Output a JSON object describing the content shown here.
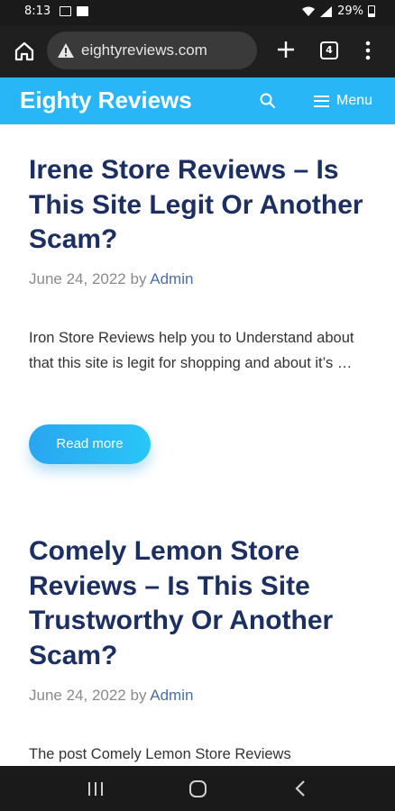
{
  "status_bar": {
    "time": "8:13",
    "battery": "29%",
    "icons": [
      "image-icon",
      "folder-icon",
      "wifi-icon",
      "signal-icon",
      "battery-icon"
    ]
  },
  "browser": {
    "url": "eightyreviews.com",
    "tab_count": "4",
    "icons": [
      "home-icon",
      "warning-icon",
      "plus-icon",
      "tabs-icon",
      "kebab-menu-icon"
    ]
  },
  "site": {
    "title": "Eighty Reviews",
    "menu_label": "Menu",
    "accent_color": "#29b6f6",
    "title_color": "#1c2f63"
  },
  "posts": [
    {
      "title": "Irene Store Reviews – Is This Site Legit Or Another Scam?",
      "date": "June 24, 2022",
      "by": "by",
      "author": "Admin",
      "excerpt": "Iron Store Reviews help you to Understand about that this site is legit for shopping and about it’s …",
      "read_more": "Read more"
    },
    {
      "title": "Comely Lemon Store Reviews – Is This Site Trustworthy Or Another Scam?",
      "date": "June 24, 2022",
      "by": "by",
      "author": "Admin",
      "excerpt": "The post Comely Lemon Store Reviews"
    }
  ],
  "nav_bar": {
    "icons": [
      "recents-icon",
      "home-circle-icon",
      "back-icon"
    ]
  }
}
